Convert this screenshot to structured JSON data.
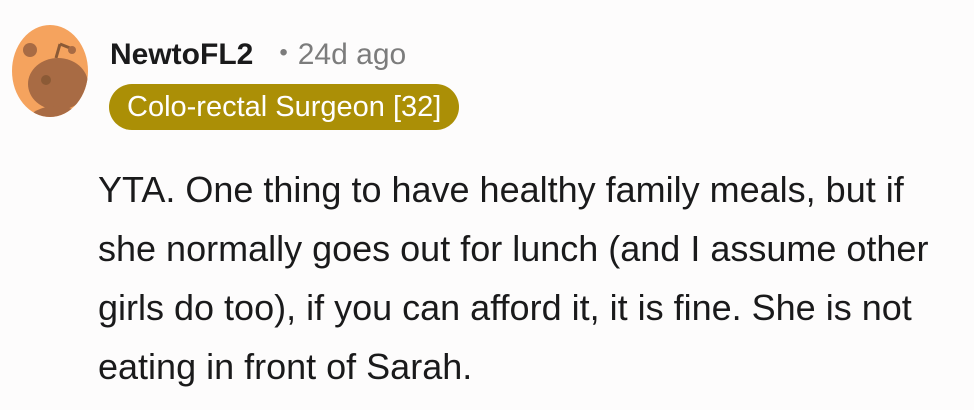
{
  "comment": {
    "author": "NewtoFL2",
    "separator": "•",
    "timestamp": "24d ago",
    "flair": "Colo-rectal Surgeon [32]",
    "flair_color": "#ab8f06",
    "avatar_icon": "reddit-snoo-avatar-icon",
    "text": "YTA. One thing to have healthy family meals, but if she normally goes out for lunch (and I assume other girls do too), if you can afford it, it is fine. She is not eating in front of Sarah."
  }
}
